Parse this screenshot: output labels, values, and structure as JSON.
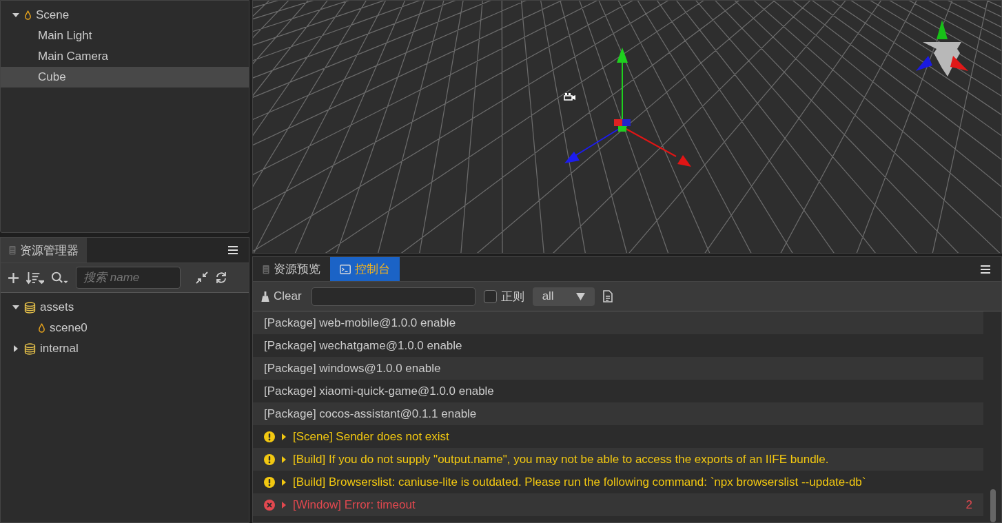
{
  "hierarchy": {
    "tree": [
      {
        "label": "Scene",
        "kind": "scene",
        "expanded": true,
        "selected": false,
        "children": [
          {
            "label": "Main Light",
            "selected": false
          },
          {
            "label": "Main Camera",
            "selected": false
          },
          {
            "label": "Cube",
            "selected": true
          }
        ]
      }
    ]
  },
  "assets": {
    "tab": "资源管理器",
    "search": {
      "placeholder": "搜索 name"
    },
    "tree": [
      {
        "label": "assets",
        "kind": "db",
        "expanded": true,
        "selected": false,
        "children": [
          {
            "label": "scene0",
            "kind": "scene",
            "selected": false
          }
        ]
      },
      {
        "label": "internal",
        "kind": "db",
        "expanded": false,
        "selected": false
      }
    ]
  },
  "console": {
    "tabs": [
      {
        "label": "资源预览",
        "kind": "preview",
        "selected": false
      },
      {
        "label": "控制台",
        "kind": "console",
        "selected": true
      }
    ],
    "clear": "Clear",
    "regex": {
      "label": "正则",
      "checked": false
    },
    "level_select": "all",
    "logs": [
      {
        "kind": "log",
        "text": "[Package] web-mobile@1.0.0 enable"
      },
      {
        "kind": "log",
        "text": "[Package] wechatgame@1.0.0 enable"
      },
      {
        "kind": "log",
        "text": "[Package] windows@1.0.0 enable"
      },
      {
        "kind": "log",
        "text": "[Package] xiaomi-quick-game@1.0.0 enable"
      },
      {
        "kind": "log",
        "text": "[Package] cocos-assistant@0.1.1 enable"
      },
      {
        "kind": "warn",
        "text": "[Scene] Sender does not exist"
      },
      {
        "kind": "warn",
        "text": "[Build] If you do not supply \"output.name\", you may not be able to access the exports of an IIFE bundle."
      },
      {
        "kind": "warn",
        "text": "[Build] Browserslist: caniuse-lite is outdated. Please run the following command: `npx browserslist --update-db`"
      },
      {
        "kind": "error",
        "text": "[Window] Error: timeout",
        "count": "2"
      }
    ]
  }
}
